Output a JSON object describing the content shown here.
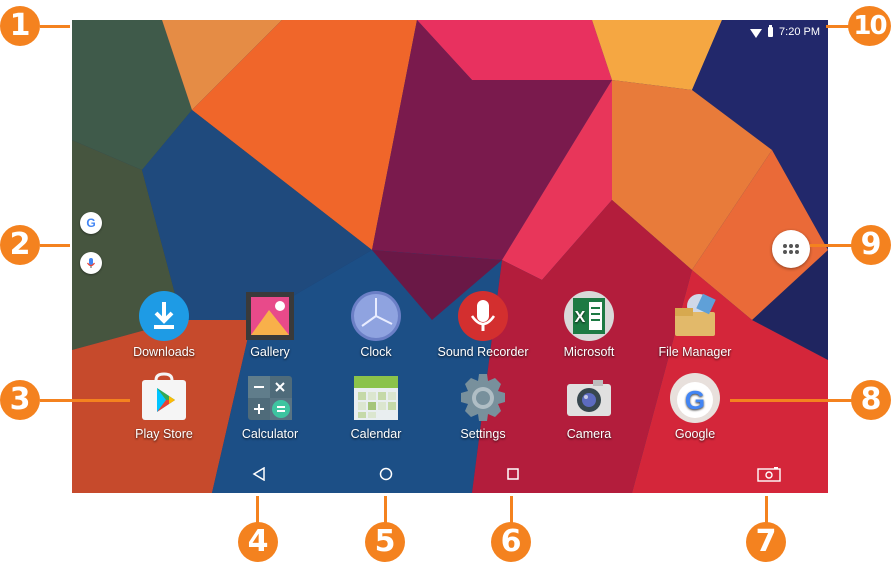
{
  "status_bar": {
    "time": "7:20 PM"
  },
  "apps_row1": [
    {
      "label": "Downloads",
      "icon": "downloads-icon"
    },
    {
      "label": "Gallery",
      "icon": "gallery-icon"
    },
    {
      "label": "Clock",
      "icon": "clock-icon"
    },
    {
      "label": "Sound Recorder",
      "icon": "sound-recorder-icon"
    },
    {
      "label": "Microsoft",
      "icon": "microsoft-folder-icon"
    },
    {
      "label": "File Manager",
      "icon": "file-manager-icon"
    }
  ],
  "apps_row2": [
    {
      "label": "Play Store",
      "icon": "play-store-icon"
    },
    {
      "label": "Calculator",
      "icon": "calculator-icon"
    },
    {
      "label": "Calendar",
      "icon": "calendar-icon"
    },
    {
      "label": "Settings",
      "icon": "settings-icon"
    },
    {
      "label": "Camera",
      "icon": "camera-icon"
    },
    {
      "label": "Google",
      "icon": "google-folder-icon"
    }
  ],
  "callouts": [
    "1",
    "2",
    "3",
    "4",
    "5",
    "6",
    "7",
    "8",
    "9",
    "10"
  ],
  "colors": {
    "callout": "#f4821f"
  }
}
